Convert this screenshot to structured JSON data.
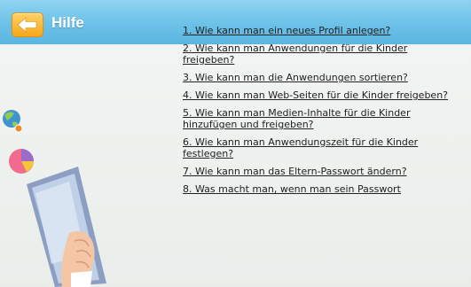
{
  "header": {
    "title": "Hilfe",
    "back_icon": "arrow-left-icon",
    "bar_color": "#6cc1e8",
    "button_color": "#f7a71a"
  },
  "faq": {
    "items": [
      {
        "label": "1. Wie kann man ein neues Profil anlegen?"
      },
      {
        "label": "2. Wie kann man Anwendungen für die Kinder freigeben?"
      },
      {
        "label": "3. Wie kann man die Anwendungen sortieren?"
      },
      {
        "label": "4. Wie kann man Web-Seiten für die Kinder freigeben?"
      },
      {
        "label": "5. Wie kann man Medien-Inhalte für die Kinder hinzufügen und freigeben?"
      },
      {
        "label": "6. Wie kann man Anwendungszeit für die Kinder festlegen?"
      },
      {
        "label": "7. Wie kann man das Eltern-Passwort ändern?"
      },
      {
        "label": "8. Was macht man, wenn man sein Passwort"
      }
    ]
  },
  "decor": {
    "icons": [
      "globe-lock-icon",
      "pie-chart-icon"
    ],
    "illustration": "hand-holding-tablet-illustration"
  }
}
